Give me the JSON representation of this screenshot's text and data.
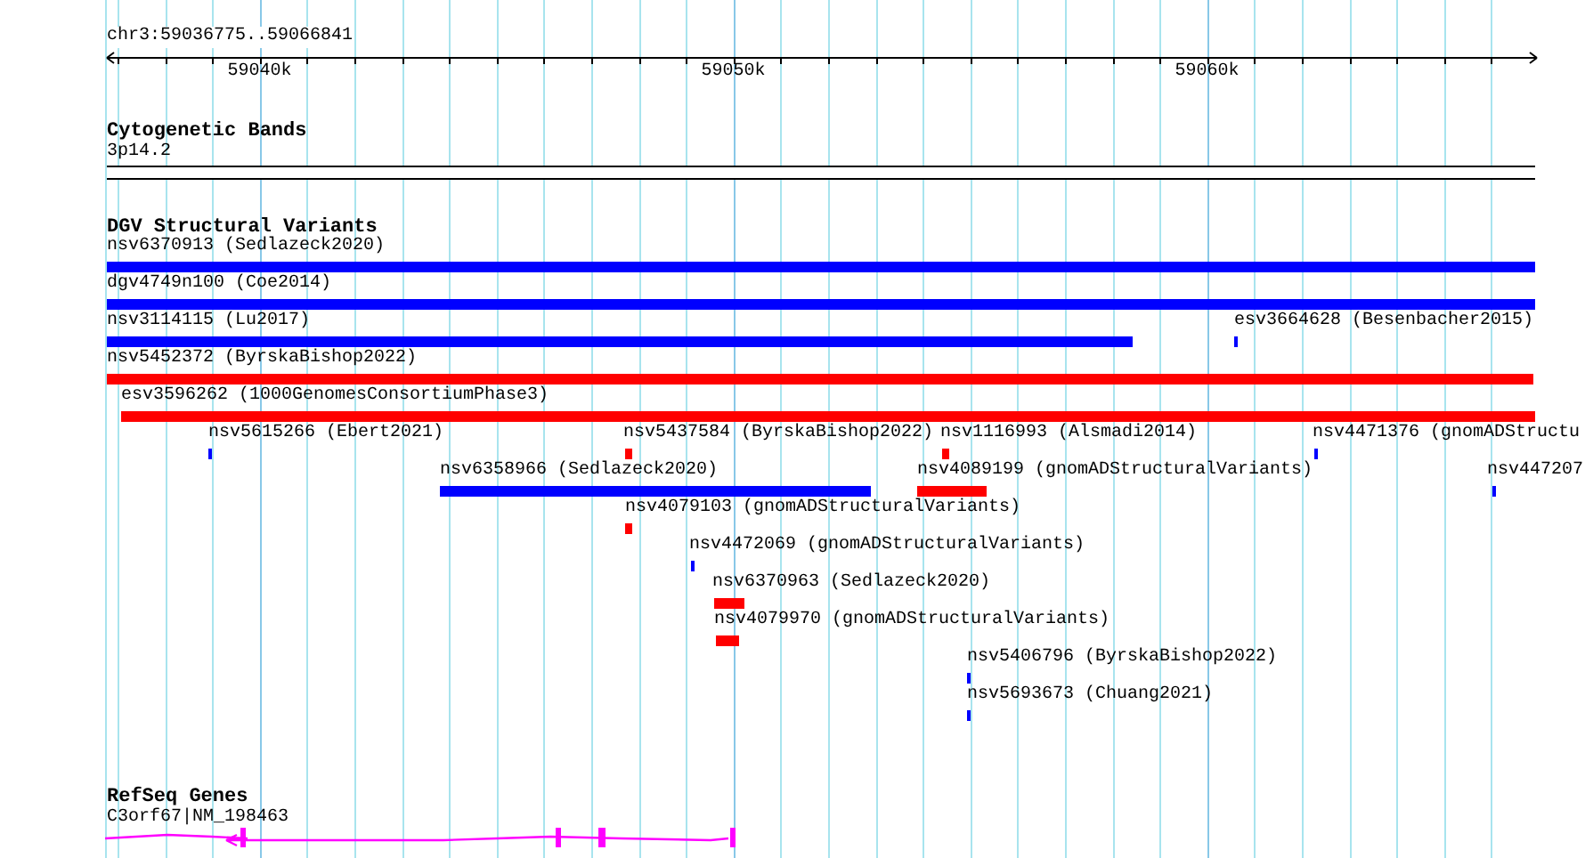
{
  "ruler": {
    "location": "chr3:59036775..59066841",
    "ticks": [
      "59040k",
      "59050k",
      "59060k"
    ]
  },
  "tracks": [
    {
      "title": "Cytogenetic Bands",
      "kind": "bands",
      "features": [
        {
          "label": "3p14.2"
        }
      ]
    },
    {
      "title": "DGV Structural Variants",
      "kind": "variants",
      "features": [
        {
          "label": "nsv6370913 (Sedlazeck2020)",
          "color": "#0000ff"
        },
        {
          "label": "dgv4749n100 (Coe2014)",
          "color": "#0000ff"
        },
        {
          "label": "nsv3114115 (Lu2017)",
          "color": "#0000ff"
        },
        {
          "label": "esv3664628 (Besenbacher2015)",
          "color": "#0000ff"
        },
        {
          "label": "nsv5452372 (ByrskaBishop2022)",
          "color": "#ff0000"
        },
        {
          "label": "esv3596262 (1000GenomesConsortiumPhase3)",
          "color": "#ff0000"
        },
        {
          "label": "nsv5615266 (Ebert2021)",
          "color": "#0000ff"
        },
        {
          "label": "nsv5437584 (ByrskaBishop2022)",
          "color": "#ff0000"
        },
        {
          "label": "nsv1116993 (Alsmadi2014)",
          "color": "#ff0000"
        },
        {
          "label": "nsv4471376 (gnomADStructu",
          "color": "#0000ff"
        },
        {
          "label": "nsv6358966 (Sedlazeck2020)",
          "color": "#0000ff"
        },
        {
          "label": "nsv4089199 (gnomADStructuralVariants)",
          "color": "#ff0000"
        },
        {
          "label": "nsv447207",
          "color": "#0000ff"
        },
        {
          "label": "nsv4079103 (gnomADStructuralVariants)",
          "color": "#ff0000"
        },
        {
          "label": "nsv4472069 (gnomADStructuralVariants)",
          "color": "#0000ff"
        },
        {
          "label": "nsv6370963 (Sedlazeck2020)",
          "color": "#ff0000"
        },
        {
          "label": "nsv4079970 (gnomADStructuralVariants)",
          "color": "#ff0000"
        },
        {
          "label": "nsv5406796 (ByrskaBishop2022)",
          "color": "#0000ff"
        },
        {
          "label": "nsv5693673 (Chuang2021)",
          "color": "#0000ff"
        }
      ]
    },
    {
      "title": "RefSeq Genes",
      "kind": "genes",
      "features": [
        {
          "label": "C3orf67|NM_198463"
        }
      ]
    }
  ]
}
